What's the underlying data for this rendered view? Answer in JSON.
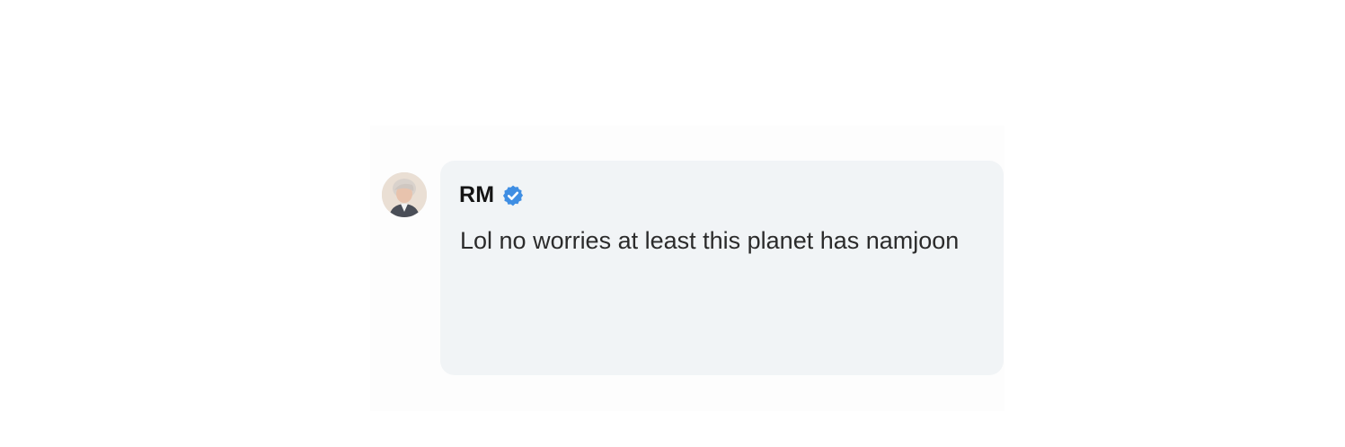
{
  "comment": {
    "author": {
      "name": "RM",
      "verified": true,
      "avatar_icon": "profile-photo",
      "verified_icon": "verified-badge-icon"
    },
    "text": "Lol no worries at least this planet has namjoon"
  },
  "colors": {
    "bubble_background": "#f1f4f6",
    "verified_badge": "#3f8ee3",
    "text": "#2b2b2b"
  }
}
